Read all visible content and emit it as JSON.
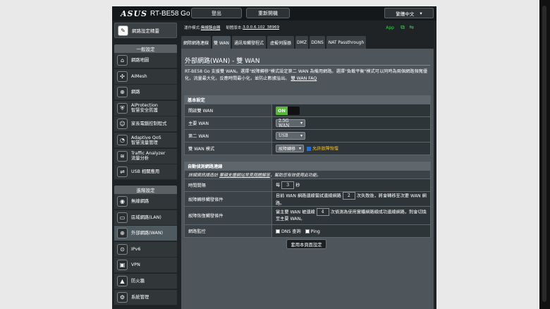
{
  "header": {
    "brand": "ASUS",
    "model": "RT-BE58 Go",
    "logout_label": "登出",
    "reboot_label": "重新開機",
    "language": "繁體中文"
  },
  "status_bar": {
    "op_mode_label": "運作模式:",
    "op_mode_value": "無線路由器",
    "firmware_label": "韌體版本:",
    "firmware_value": "3.0.0.6.102_38969",
    "app_label": "App"
  },
  "sidebar": {
    "wizard_label": "網路設定精靈",
    "general_header": "一般設定",
    "general_items": [
      {
        "label": "網路地圖",
        "icon": "network-map-icon",
        "glyph": "⌂"
      },
      {
        "label": "AiMesh",
        "icon": "aimesh-icon",
        "glyph": "✣"
      },
      {
        "label": "網路",
        "icon": "globe-icon",
        "glyph": "⊕"
      },
      {
        "label": "AiProtection\n智慧安全防護",
        "icon": "shield-icon",
        "glyph": "⛨"
      },
      {
        "label": "家長電腦控制程式",
        "icon": "parental-control-icon",
        "glyph": "☺"
      },
      {
        "label": "Adaptive QoS\n智慧流量管理",
        "icon": "qos-icon",
        "glyph": "◔"
      },
      {
        "label": "Traffic Analyzer\n流量分析",
        "icon": "traffic-analyzer-icon",
        "glyph": "≋"
      },
      {
        "label": "USB 相關應用",
        "icon": "usb-icon",
        "glyph": "⇌"
      }
    ],
    "advanced_header": "進階設定",
    "advanced_items": [
      {
        "label": "無線網路",
        "icon": "wireless-icon",
        "glyph": "◉"
      },
      {
        "label": "區域網路(LAN)",
        "icon": "lan-icon",
        "glyph": "▭"
      },
      {
        "label": "外部網路(WAN)",
        "icon": "wan-icon",
        "glyph": "⊕",
        "active": true
      },
      {
        "label": "IPv6",
        "icon": "ipv6-icon",
        "glyph": "⊙"
      },
      {
        "label": "VPN",
        "icon": "vpn-icon",
        "glyph": "▣"
      },
      {
        "label": "防火牆",
        "icon": "firewall-icon",
        "glyph": "▲"
      },
      {
        "label": "系統管理",
        "icon": "gear-icon",
        "glyph": "⚙"
      }
    ]
  },
  "tabs": [
    {
      "label": "網際網路連線",
      "w": 42
    },
    {
      "label": "雙 WAN",
      "w": 26,
      "active": true
    },
    {
      "label": "通訊埠觸發程式",
      "w": 48
    },
    {
      "label": "虛擬伺服器",
      "w": 38
    },
    {
      "label": "DMZ",
      "w": 18
    },
    {
      "label": "DDNS",
      "w": 22
    },
    {
      "label": "NAT Passthrough",
      "w": 56
    }
  ],
  "page": {
    "title": "外部網路(WAN) - 雙 WAN",
    "description": "RT-BE58 Go 支援雙 WAN。選擇\"故障轉移\"模式設定第二 WAN 為備用網路。選擇\"負載平衡\"模式可以同時為兩個網路頻寬優化，流量最大化，反應時間最小化，並防止數據溢出。",
    "faq_link": "雙 WAN FAQ"
  },
  "basic": {
    "header": "基本設定",
    "enable_label": "開啟雙 WAN",
    "enable_state": "ON",
    "primary_label": "主要 WAN",
    "primary_value": "2.5G WAN",
    "secondary_label": "第二 WAN",
    "secondary_value": "USB",
    "mode_label": "雙 WAN 模式",
    "mode_value": "故障轉移",
    "failback_label": "允許故障恢復"
  },
  "detect": {
    "header": "自動偵測網路連線",
    "note_prefix": "詳細資訊請造訪",
    "note_link": "華碩支援網站常見問題解答",
    "note_suffix": "，幫助您有效使用此功能。",
    "interval_label": "時間間隔",
    "interval_prefix": "每",
    "interval_value": "3",
    "interval_unit": "秒",
    "failover_label": "故障轉移觸發條件",
    "failover_prefix": "目前 WAN 網路連線嘗試連線網路",
    "failover_value": "2",
    "failover_suffix": "次失敗後，將會轉移至次要 WAN 網路。",
    "failback_trigger_label": "故障恢復觸發條件",
    "failback_prefix": "當主要 WAN 被連線",
    "failback_value": "4",
    "failback_suffix": "次偵測為使用實體網路線成功連線網路，則會切換至主要 WAN。",
    "monitor_label": "網路監控",
    "dns_label": "DNS 查詢",
    "ping_label": "Ping"
  },
  "apply_label": "套用本頁面設定"
}
